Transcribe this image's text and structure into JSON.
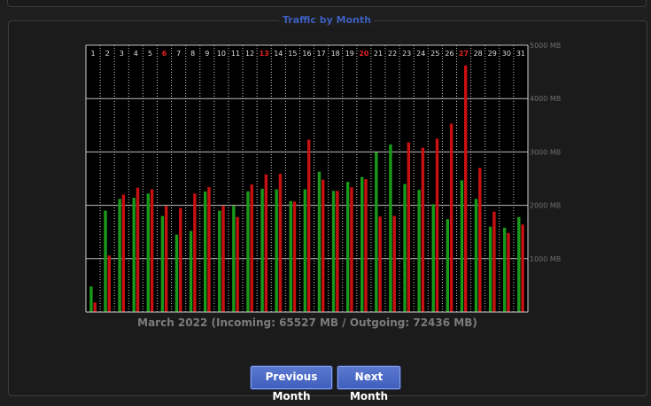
{
  "page": {
    "legend": "Traffic by Month",
    "summary": "March 2022 (Incoming: 65527 MB / Outgoing: 72436 MB)",
    "buttons": {
      "previous": "Previous Month",
      "next": "Next Month"
    }
  },
  "chart_data": {
    "type": "bar",
    "title": "",
    "xlabel": "",
    "ylabel": "",
    "ylim": [
      0,
      5000
    ],
    "y_ticks": [
      1000,
      2000,
      3000,
      4000,
      5000
    ],
    "y_tick_labels": [
      "1000 MB",
      "2000 MB",
      "3000 MB",
      "4000 MB",
      "5000 MB"
    ],
    "grid": true,
    "categories": [
      "1",
      "2",
      "3",
      "4",
      "5",
      "6",
      "7",
      "8",
      "9",
      "10",
      "11",
      "12",
      "13",
      "14",
      "15",
      "16",
      "17",
      "18",
      "19",
      "20",
      "21",
      "22",
      "23",
      "24",
      "25",
      "26",
      "27",
      "28",
      "29",
      "30",
      "31"
    ],
    "highlighted_categories": [
      "6",
      "13",
      "20",
      "27"
    ],
    "series": [
      {
        "color": "#1a9a1a",
        "values": [
          480,
          1900,
          2120,
          2140,
          2220,
          1800,
          1450,
          1520,
          2260,
          1900,
          1990,
          2260,
          2310,
          2300,
          2080,
          2300,
          2630,
          2270,
          2440,
          2530,
          2990,
          3140,
          2400,
          2290,
          2020,
          1740,
          2470,
          2120,
          1600,
          1580,
          1780
        ]
      },
      {
        "color": "#c91010",
        "values": [
          180,
          1060,
          2200,
          2330,
          2300,
          1990,
          1950,
          2220,
          2340,
          1990,
          1780,
          2390,
          2580,
          2590,
          2070,
          3230,
          2480,
          2270,
          2340,
          2490,
          1790,
          1800,
          3180,
          3080,
          3250,
          3530,
          4620,
          2700,
          1880,
          1480,
          1640
        ]
      }
    ],
    "highlight_color": "#e02020",
    "label_color": "#dddddd"
  }
}
